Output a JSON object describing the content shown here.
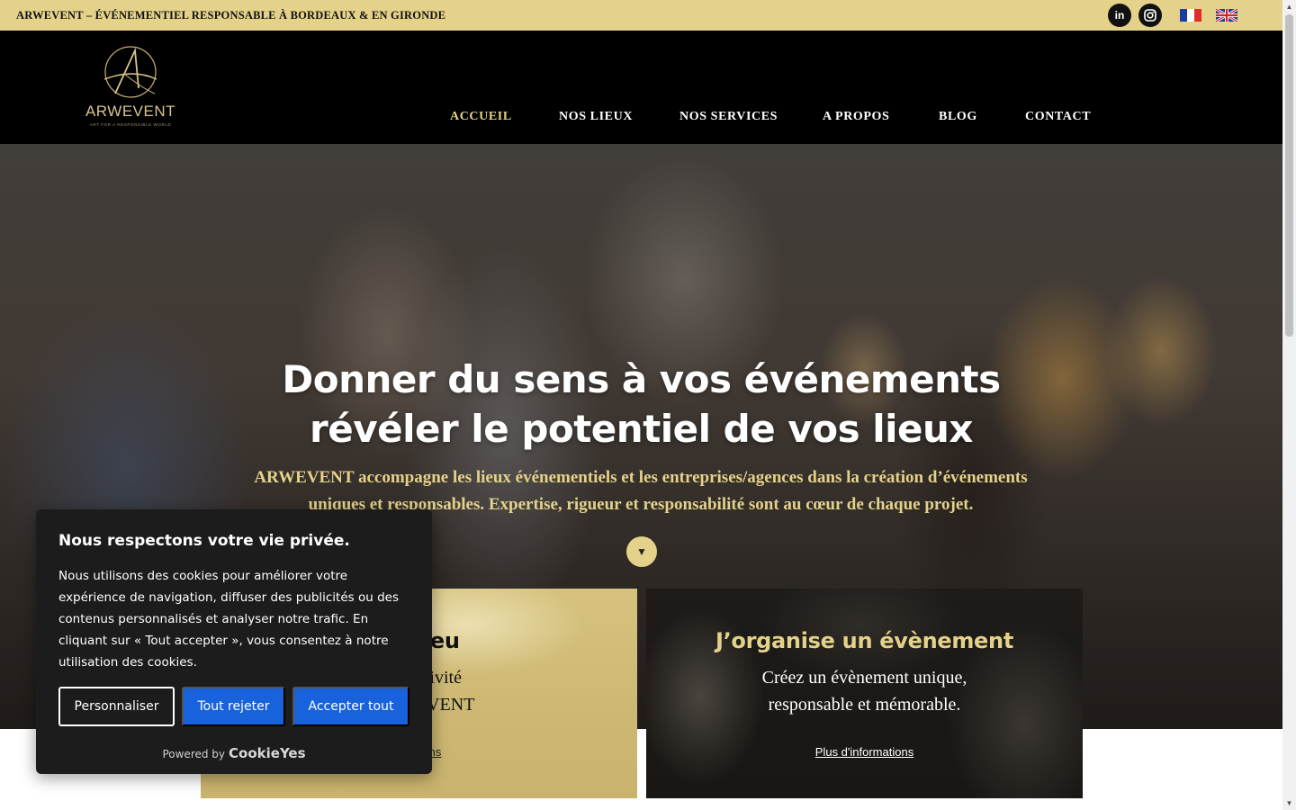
{
  "topbar": {
    "tagline": "ARWEVENT – ÉVÉNEMENTIEL RESPONSABLE À BORDEAUX & EN GIRONDE",
    "social": {
      "linkedin_label": "in"
    }
  },
  "header": {
    "logo": {
      "brand": "ARWEVENT",
      "tagline": "ART FOR A RESPONSIBLE WORLD"
    },
    "nav": [
      {
        "label": "ACCUEIL"
      },
      {
        "label": "NOS LIEUX"
      },
      {
        "label": "NOS SERVICES"
      },
      {
        "label": "A PROPOS"
      },
      {
        "label": "BLOG"
      },
      {
        "label": "CONTACT"
      }
    ]
  },
  "hero": {
    "title_line1": "Donner du sens à vos événements",
    "title_line2": "révéler le potentiel de vos lieux",
    "subtitle": "ARWEVENT accompagne les lieux événementiels et les entreprises/agences dans la création d’événements uniques et responsables. Expertise, rigueur et responsabilité sont au cœur de chaque projet.",
    "scroll_icon": "▼"
  },
  "cards": [
    {
      "title": "un lieu",
      "text_line1": "otre activité",
      "text_line2": "c ARWEVENT",
      "link": "rmations"
    },
    {
      "title": "J’organise un évènement",
      "text_line1": "Créez un évènement unique,",
      "text_line2": "responsable et mémorable.",
      "link": "Plus d'informations"
    }
  ],
  "cookie_banner": {
    "title": "Nous respectons votre vie privée.",
    "text": "Nous utilisons des cookies pour améliorer votre expérience de navigation, diffuser des publicités ou des contenus personnalisés et analyser notre trafic. En cliquant sur « Tout accepter », vous consentez à notre utilisation des cookies.",
    "buttons": {
      "customize": "Personnaliser",
      "reject": "Tout rejeter",
      "accept": "Accepter tout"
    },
    "powered_by": "Powered by",
    "powered_brand": "CookieYes"
  },
  "colors": {
    "gold": "#e4d28a",
    "black": "#000000",
    "cookie_bg": "#1c1c1c",
    "button_blue": "#1863dc"
  },
  "icons": [
    "linkedin-icon",
    "instagram-icon",
    "french-flag-icon",
    "uk-flag-icon",
    "chevron-down-icon"
  ]
}
